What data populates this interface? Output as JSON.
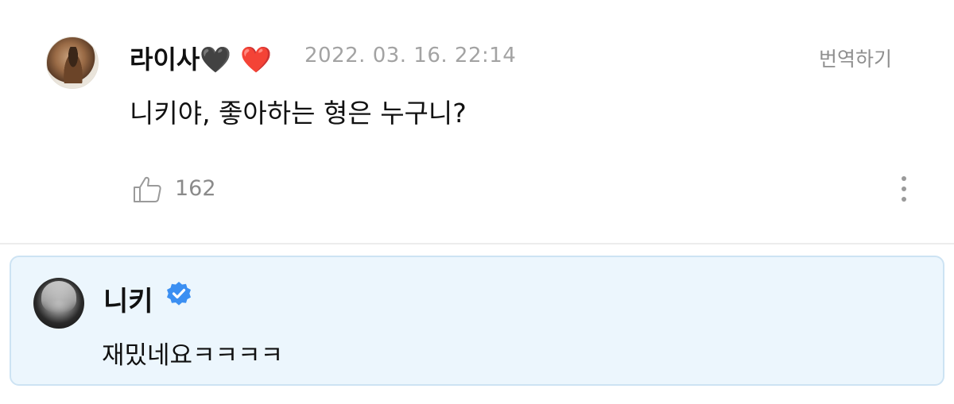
{
  "comment": {
    "author": "라이사🖤 ❤️",
    "timestamp": "2022. 03. 16. 22:14",
    "translate_label": "번역하기",
    "text": "니키야, 좋아하는 형은 누구니?",
    "likes": "162",
    "icons": {
      "like": "thumbs-up-icon",
      "more": "more-vertical-icon"
    }
  },
  "reply": {
    "author": "니키",
    "verified": true,
    "text": "재밌네요ㅋㅋㅋㅋ",
    "colors": {
      "background": "#ecf6fd",
      "border": "#cde3f3",
      "verified_badge": "#3b8ff2"
    }
  }
}
